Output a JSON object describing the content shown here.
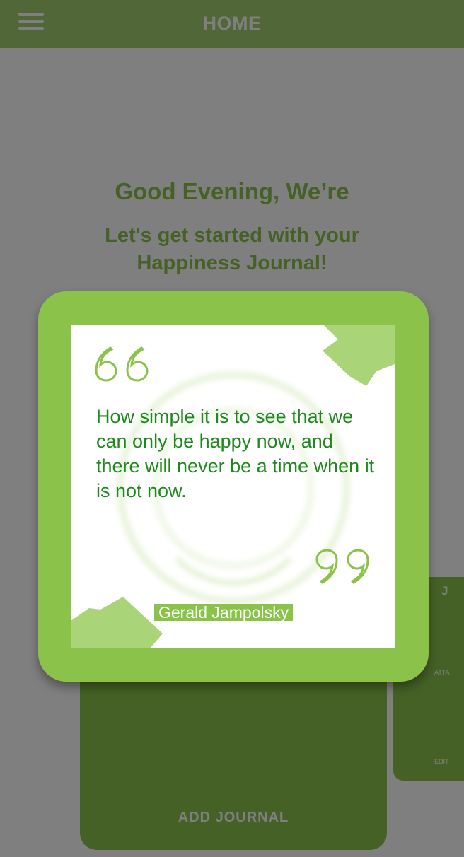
{
  "header": {
    "title": "HOME",
    "menu_icon": "hamburger-menu-icon"
  },
  "main": {
    "greeting": "Good Evening, We’re",
    "subtitle": "Let's get started with your Happiness Journal!",
    "add_journal_label": "ADD JOURNAL",
    "side_card": {
      "title": "J",
      "label_1": "ATTA",
      "label_2": "EDIT"
    }
  },
  "quote_modal": {
    "quote": "How simple it is to see that we can only be happy now, and there will never be a time when it is not now.",
    "author": "Gerald Jampolsky",
    "open_quote_icon": "open-quote-icon",
    "close_quote_icon": "close-quote-icon"
  },
  "colors": {
    "brand_green": "#8bc34a",
    "nav_green": "#a3cf6e",
    "quote_text": "#1e8a1e",
    "overlay": "rgba(0,0,0,0.5)"
  }
}
